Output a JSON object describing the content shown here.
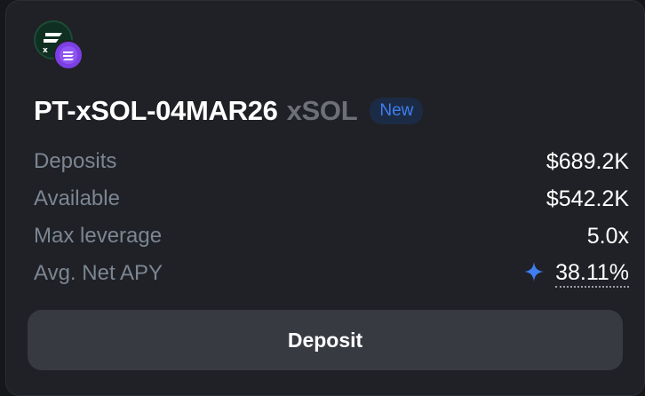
{
  "market": {
    "title": "PT-xSOL-04MAR26",
    "underlying": "xSOL",
    "badge": "New",
    "icons": {
      "main": "xsol-logo-icon",
      "badge": "stake-token-icon",
      "apy": "sparkle-icon"
    }
  },
  "stats": [
    {
      "label": "Deposits",
      "value": "$689.2K"
    },
    {
      "label": "Available",
      "value": "$542.2K"
    },
    {
      "label": "Max leverage",
      "value": "5.0x"
    },
    {
      "label": "Avg. Net APY",
      "value": "38.11%"
    }
  ],
  "actions": {
    "deposit_label": "Deposit"
  },
  "colors": {
    "card_bg": "#202126",
    "accent_blue": "#3f7ef0",
    "label_gray": "#7b8693"
  }
}
